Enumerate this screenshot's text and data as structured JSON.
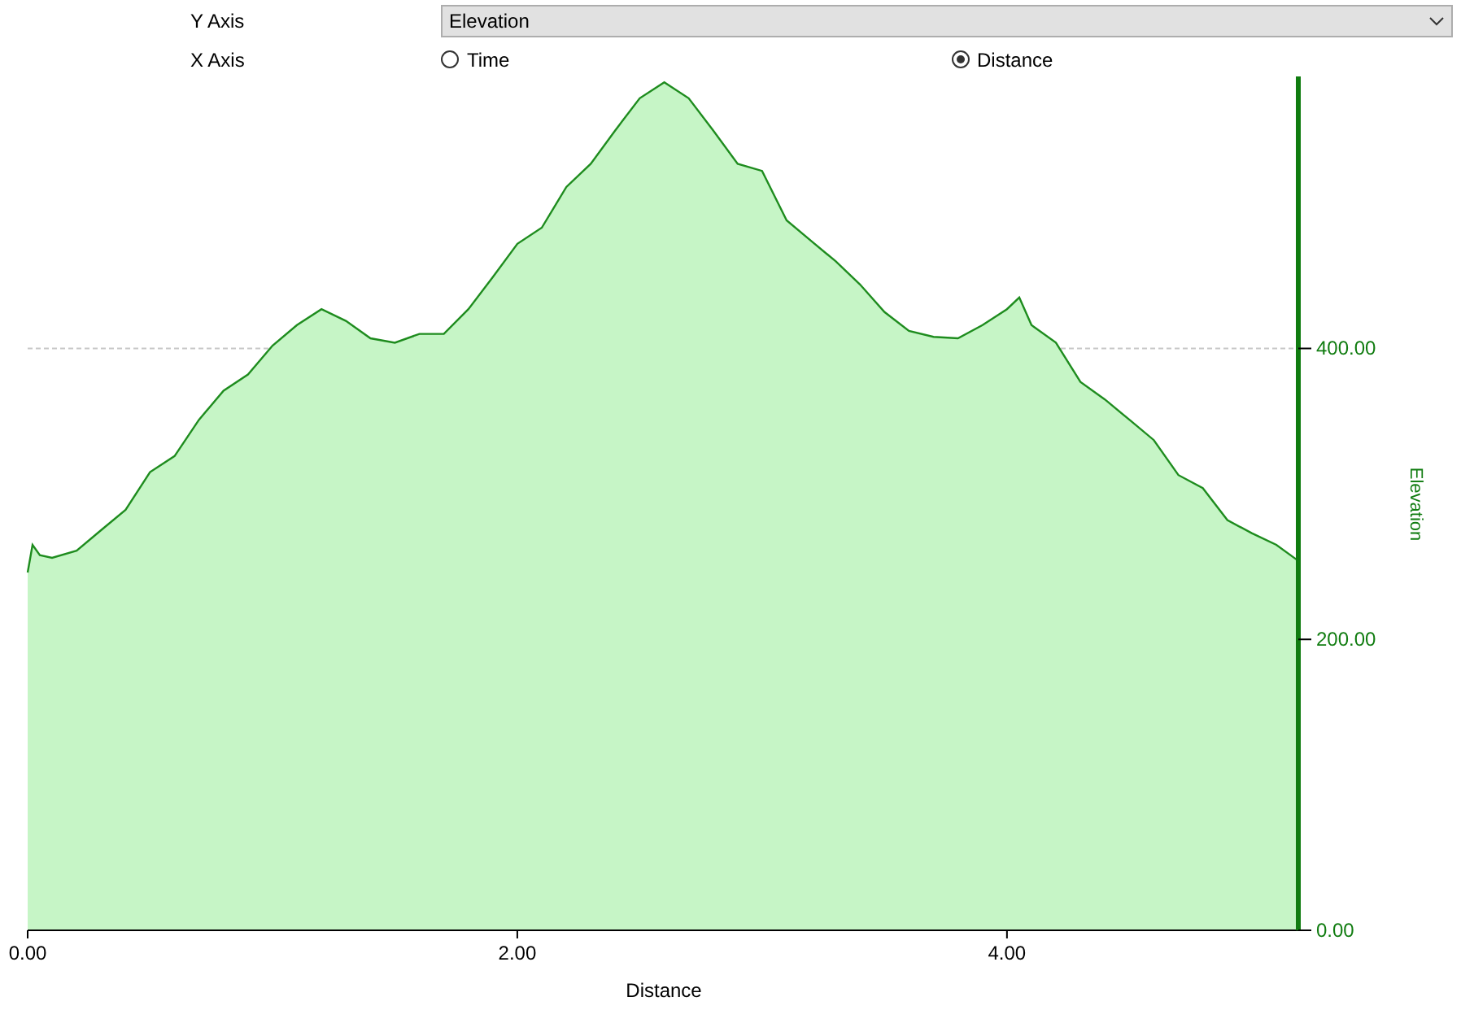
{
  "controls": {
    "y_axis": {
      "label": "Y Axis",
      "value": "Elevation"
    },
    "x_axis": {
      "label": "X Axis",
      "options": [
        {
          "label": "Time",
          "selected": false
        },
        {
          "label": "Distance",
          "selected": true
        }
      ]
    }
  },
  "chart": {
    "chart_data": {
      "type": "area",
      "xlabel": "Distance",
      "ylabel": "Elevation",
      "xlim": [
        0,
        5.19
      ],
      "ylim": [
        0,
        587
      ],
      "xticks": [
        {
          "value": 0,
          "label": "0.00"
        },
        {
          "value": 2,
          "label": "2.00"
        },
        {
          "value": 4,
          "label": "4.00"
        }
      ],
      "yticks": [
        {
          "value": 0,
          "label": "0.00"
        },
        {
          "value": 200,
          "label": "200.00"
        },
        {
          "value": 400,
          "label": "400.00"
        }
      ],
      "x": [
        0,
        0.02,
        0.05,
        0.1,
        0.2,
        0.3,
        0.4,
        0.5,
        0.6,
        0.7,
        0.8,
        0.9,
        1.0,
        1.1,
        1.2,
        1.3,
        1.4,
        1.5,
        1.6,
        1.7,
        1.8,
        1.9,
        2.0,
        2.1,
        2.2,
        2.3,
        2.4,
        2.5,
        2.6,
        2.7,
        2.8,
        2.9,
        3.0,
        3.1,
        3.2,
        3.3,
        3.4,
        3.5,
        3.6,
        3.7,
        3.8,
        3.9,
        4.0,
        4.05,
        4.1,
        4.2,
        4.3,
        4.4,
        4.5,
        4.6,
        4.7,
        4.8,
        4.9,
        5.0,
        5.1,
        5.19
      ],
      "series": [
        {
          "color": "#1e8c1e",
          "values": [
            246,
            265,
            258,
            256,
            261,
            275,
            289,
            315,
            326,
            351,
            371,
            382,
            402,
            416,
            427,
            419,
            407,
            404,
            410,
            410,
            427,
            449,
            472,
            483,
            511,
            527,
            550,
            572,
            583,
            572,
            550,
            527,
            522,
            488,
            474,
            460,
            444,
            425,
            412,
            408,
            407,
            416,
            427,
            435,
            416,
            404,
            377,
            365,
            351,
            337,
            313,
            304,
            282,
            273,
            265,
            254
          ]
        }
      ]
    }
  }
}
